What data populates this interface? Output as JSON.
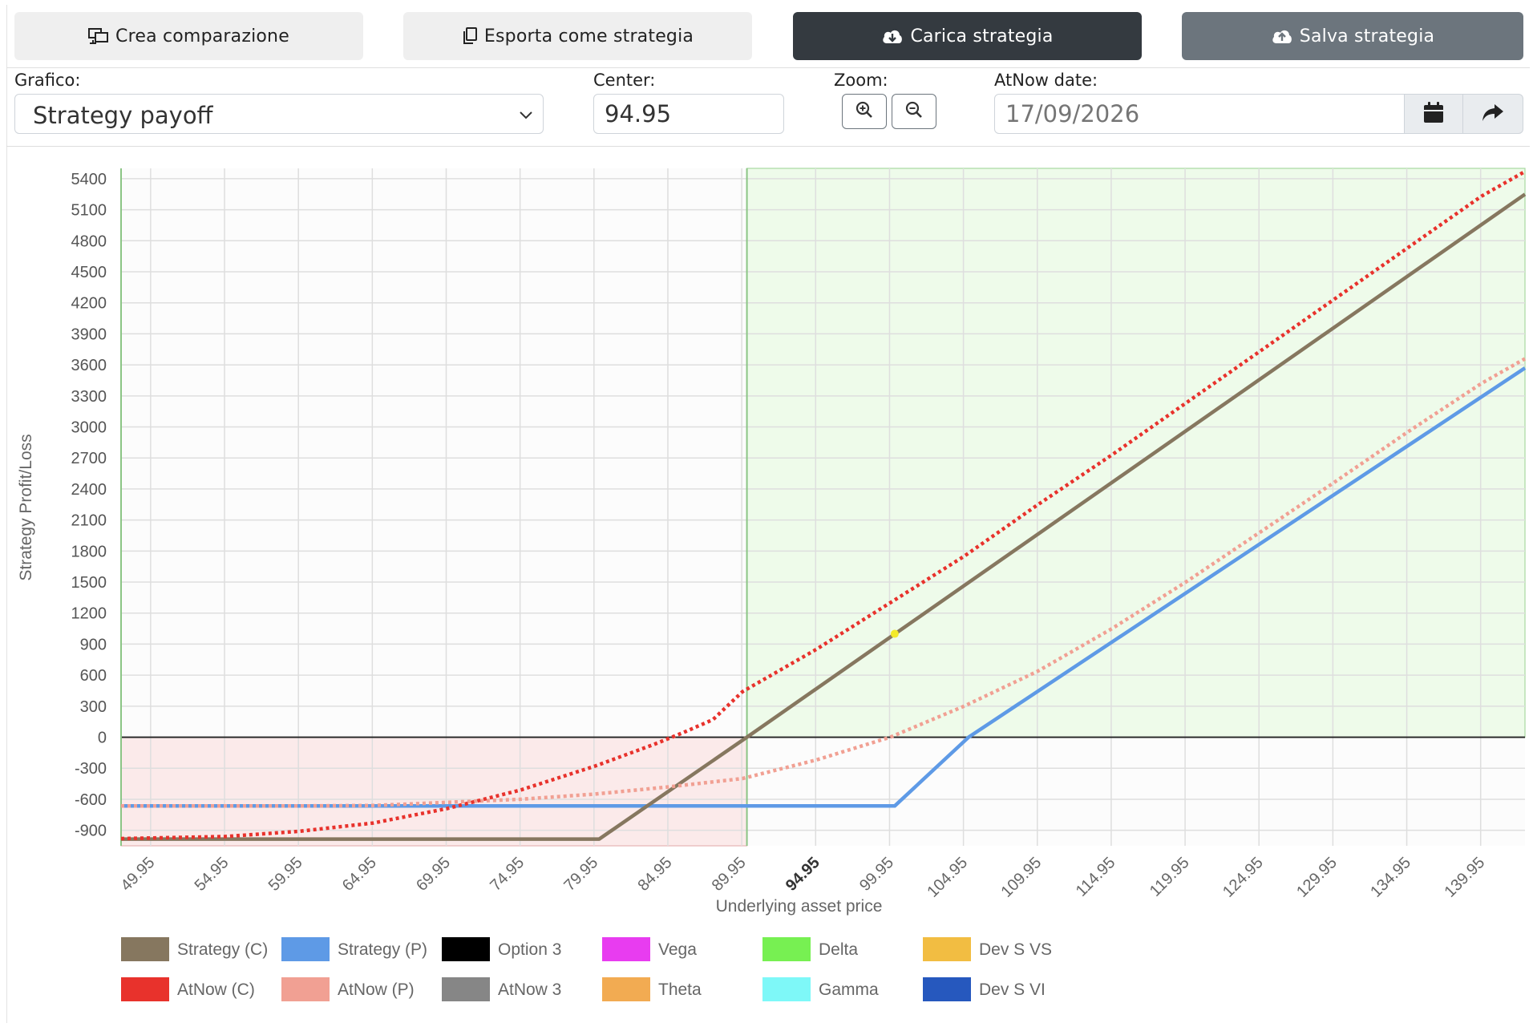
{
  "toolbar": {
    "compare_label": "Crea comparazione",
    "export_label": "Esporta come strategia",
    "load_label": "Carica strategia",
    "save_label": "Salva strategia"
  },
  "controls": {
    "chart_label": "Grafico:",
    "chart_selected": "Strategy payoff",
    "center_label": "Center:",
    "center_value": "94.95",
    "zoom_label": "Zoom:",
    "atnow_label": "AtNow date:",
    "atnow_placeholder": "17/09/2026"
  },
  "chart_data": {
    "type": "line",
    "xlabel": "Underlying asset price",
    "ylabel": "Strategy Profit/Loss",
    "xlim": [
      47.95,
      142.95
    ],
    "ylim": [
      -1050,
      5500
    ],
    "x_ticks": [
      "49.95",
      "54.95",
      "59.95",
      "64.95",
      "69.95",
      "74.95",
      "79.95",
      "84.95",
      "89.95",
      "94.95",
      "99.95",
      "104.95",
      "109.95",
      "114.95",
      "119.95",
      "124.95",
      "129.95",
      "134.95",
      "139.95"
    ],
    "y_ticks": [
      5400,
      5100,
      4800,
      4500,
      4200,
      3900,
      3600,
      3300,
      3000,
      2700,
      2400,
      2100,
      1800,
      1500,
      1200,
      900,
      600,
      300,
      0,
      -300,
      -600,
      -900
    ],
    "center": 94.95,
    "loss_zone": [
      47.95,
      90.3
    ],
    "profit_zone": [
      90.3,
      142.95
    ],
    "series": [
      {
        "name": "Strategy (C)",
        "color": "#86775f",
        "style": "solid",
        "x": [
          47.95,
          80.3,
          90.3,
          142.95
        ],
        "y": [
          -985,
          -985,
          0,
          5250
        ]
      },
      {
        "name": "Strategy (P)",
        "color": "#5e9ae6",
        "style": "solid",
        "x": [
          47.95,
          100.3,
          105.3,
          142.95
        ],
        "y": [
          -665,
          -665,
          0,
          3570
        ]
      },
      {
        "name": "AtNow (C)",
        "color": "#e8322c",
        "style": "dotted",
        "x": [
          47.95,
          55,
          60,
          65,
          70,
          75,
          80,
          84,
          86,
          88,
          90,
          95,
          100,
          105,
          110,
          115,
          120,
          125,
          130,
          135,
          140,
          142.95
        ],
        "y": [
          -980,
          -960,
          -910,
          -830,
          -690,
          -510,
          -280,
          -70,
          45,
          170,
          440,
          850,
          1300,
          1750,
          2250,
          2730,
          3230,
          3730,
          4230,
          4730,
          5230,
          5470
        ]
      },
      {
        "name": "AtNow (P)",
        "color": "#f1a093",
        "style": "dotted",
        "x": [
          47.95,
          60,
          65,
          70,
          75,
          80,
          85,
          90,
          95,
          100,
          105,
          110,
          115,
          120,
          125,
          130,
          135,
          140,
          142.95
        ],
        "y": [
          -665,
          -665,
          -660,
          -630,
          -600,
          -550,
          -480,
          -400,
          -220,
          0,
          300,
          640,
          1050,
          1500,
          1980,
          2460,
          2950,
          3420,
          3660
        ]
      }
    ],
    "marker": {
      "x": 100.3,
      "y": 1000,
      "color": "#f3ea2a"
    },
    "legend": [
      {
        "name": "Strategy (C)",
        "color": "#86775f"
      },
      {
        "name": "Strategy (P)",
        "color": "#5e9ae6"
      },
      {
        "name": "Option 3",
        "color": "#000000"
      },
      {
        "name": "Vega",
        "color": "#e83cf0"
      },
      {
        "name": "Delta",
        "color": "#77f052"
      },
      {
        "name": "Dev S VS",
        "color": "#f2bd42"
      },
      {
        "name": "AtNow (C)",
        "color": "#e8322c"
      },
      {
        "name": "AtNow (P)",
        "color": "#f1a093"
      },
      {
        "name": "AtNow 3",
        "color": "#868686"
      },
      {
        "name": "Theta",
        "color": "#f2ab52"
      },
      {
        "name": "Gamma",
        "color": "#7ef8f8"
      },
      {
        "name": "Dev S VI",
        "color": "#2658be"
      }
    ],
    "legend_placement": "bottom",
    "grid": true
  },
  "icons": {
    "compare": "compare-screens-icon",
    "export": "copy-icon",
    "load": "cloud-download-icon",
    "save": "cloud-upload-icon",
    "zoom_in": "zoom-in-icon",
    "zoom_out": "zoom-out-icon",
    "calendar": "calendar-icon",
    "apply": "share-arrow-icon"
  }
}
